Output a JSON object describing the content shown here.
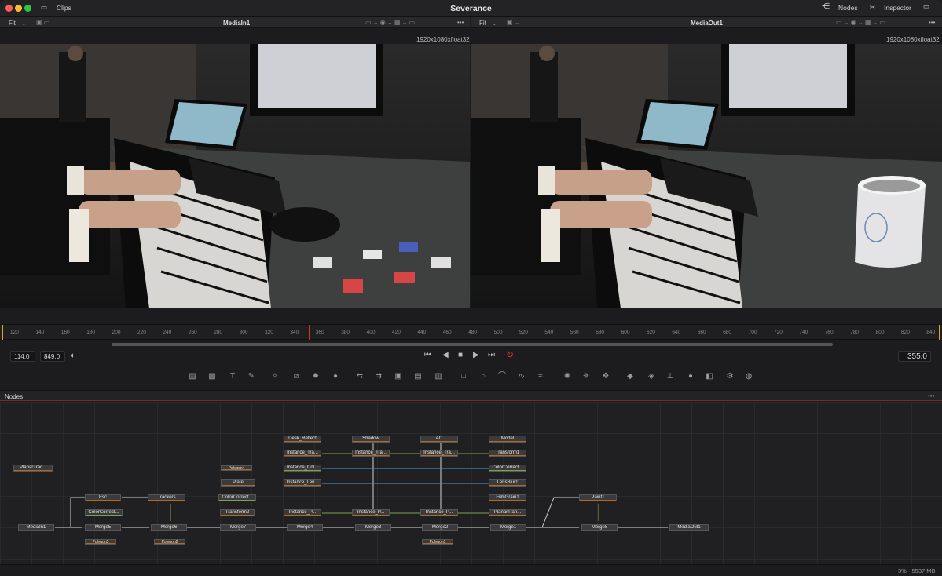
{
  "app": {
    "title": "Severance",
    "clips_label": "Clips",
    "nodes_label": "Nodes",
    "inspector_label": "Inspector"
  },
  "viewer_left": {
    "fit": "Fit",
    "name": "MediaIn1",
    "resolution": "1920x1080xfloat32",
    "more": "•••"
  },
  "viewer_right": {
    "fit": "Fit",
    "name": "MediaOut1",
    "resolution": "1920x1080xfloat32",
    "more": "•••"
  },
  "ruler": {
    "ticks": [
      "120",
      "140",
      "160",
      "180",
      "200",
      "220",
      "240",
      "260",
      "280",
      "300",
      "320",
      "340",
      "360",
      "380",
      "400",
      "420",
      "440",
      "460",
      "480",
      "500",
      "520",
      "540",
      "560",
      "580",
      "600",
      "620",
      "640",
      "660",
      "680",
      "700",
      "720",
      "740",
      "760",
      "780",
      "800",
      "820",
      "840"
    ]
  },
  "transport": {
    "start": "114.0",
    "end": "849.0",
    "current": "355.0"
  },
  "nodes_panel": {
    "title": "Nodes",
    "more": "•••"
  },
  "nodes": [
    {
      "id": "desk",
      "label": "Desk_Reflect"
    },
    {
      "id": "shadow",
      "label": "Shadow"
    },
    {
      "id": "ao",
      "label": "AO"
    },
    {
      "id": "model",
      "label": "Model"
    },
    {
      "id": "it1",
      "label": "Instance_Tra..."
    },
    {
      "id": "it2",
      "label": "Instance_Tra..."
    },
    {
      "id": "it3",
      "label": "Instance_Tra..."
    },
    {
      "id": "transform1",
      "label": "Transform1"
    },
    {
      "id": "icol",
      "label": "Instance_Col..."
    },
    {
      "id": "cc1",
      "label": "ColorCorrect..."
    },
    {
      "id": "ilen",
      "label": "Instance_Len..."
    },
    {
      "id": "lens",
      "label": "LensBlur1"
    },
    {
      "id": "planar",
      "label": "PlanarTrac..."
    },
    {
      "id": "poly4",
      "label": "Polygon4"
    },
    {
      "id": "plate",
      "label": "Plate"
    },
    {
      "id": "cc2",
      "label": "ColorCorrect..."
    },
    {
      "id": "esc",
      "label": "Esc"
    },
    {
      "id": "trackers",
      "label": "Trackers"
    },
    {
      "id": "film",
      "label": "FilmGrain1"
    },
    {
      "id": "paint",
      "label": "Paint1"
    },
    {
      "id": "cc3",
      "label": "ColorCorrect..."
    },
    {
      "id": "transform2",
      "label": "Transform2"
    },
    {
      "id": "ip1",
      "label": "Instance_P..."
    },
    {
      "id": "ip2",
      "label": "Instance_P..."
    },
    {
      "id": "ip3",
      "label": "Instance_P..."
    },
    {
      "id": "ptrans",
      "label": "PlanarTran..."
    },
    {
      "id": "mediain",
      "label": "MediaIn1"
    },
    {
      "id": "merge5",
      "label": "Merge5"
    },
    {
      "id": "merge6",
      "label": "Merge6"
    },
    {
      "id": "merge7",
      "label": "Merge7"
    },
    {
      "id": "merge4",
      "label": "Merge4"
    },
    {
      "id": "merge3",
      "label": "Merge3"
    },
    {
      "id": "merge2",
      "label": "Merge2"
    },
    {
      "id": "merge1",
      "label": "Merge1"
    },
    {
      "id": "merge8",
      "label": "Merge8"
    },
    {
      "id": "mediaout",
      "label": "MediaOut1"
    },
    {
      "id": "poly3",
      "label": "Polygon3"
    },
    {
      "id": "poly2",
      "label": "Polygon2"
    },
    {
      "id": "poly1",
      "label": "Polygon1"
    }
  ],
  "status": {
    "memory": "3% - 5537 MB"
  },
  "colors": {
    "accent_red": "#d0352d",
    "node_orange": "#b06a28",
    "node_green": "#7aa34a",
    "link_blue": "#3ea3d8"
  }
}
